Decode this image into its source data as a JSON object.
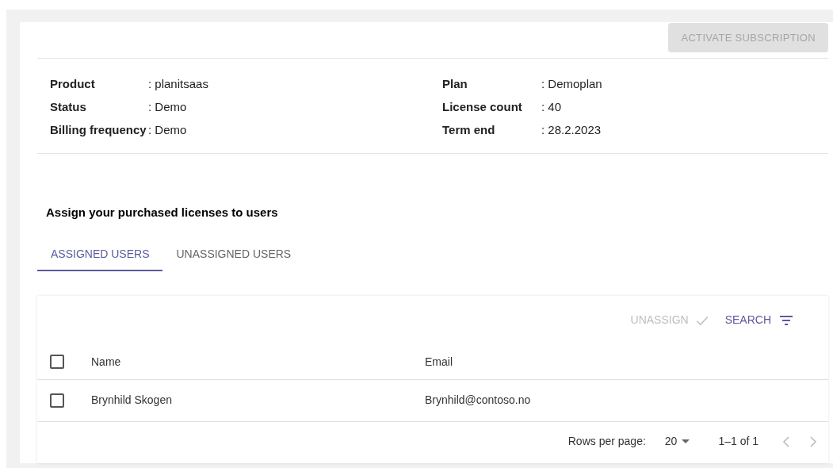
{
  "activate_button": {
    "label": "ACTIVATE SUBSCRIPTION",
    "disabled": true
  },
  "details_left": [
    {
      "label": "Product",
      "value": ": planitsaas"
    },
    {
      "label": "Status",
      "value": ": Demo"
    },
    {
      "label": "Billing frequency",
      "value": ": Demo"
    }
  ],
  "details_right": [
    {
      "label": "Plan",
      "value": ": Demoplan"
    },
    {
      "label": "License count",
      "value": ": 40"
    },
    {
      "label": "Term end",
      "value": ": 28.2.2023"
    }
  ],
  "section_title": "Assign your purchased licenses to users",
  "tabs": [
    {
      "label": "ASSIGNED USERS",
      "selected": true
    },
    {
      "label": "UNASSIGNED USERS",
      "selected": false
    }
  ],
  "toolbar": {
    "unassign": {
      "label": "UNASSIGN",
      "disabled": true
    },
    "search": {
      "label": "SEARCH",
      "disabled": false
    }
  },
  "table": {
    "columns": [
      "Name",
      "Email"
    ],
    "select_all_checked": false,
    "rows": [
      {
        "name": "Brynhild Skogen",
        "email": "Brynhild@contoso.no",
        "checked": false
      }
    ]
  },
  "pagination": {
    "rows_per_page_label": "Rows per page:",
    "rows_per_page": "20",
    "range": "1–1 of 1"
  }
}
